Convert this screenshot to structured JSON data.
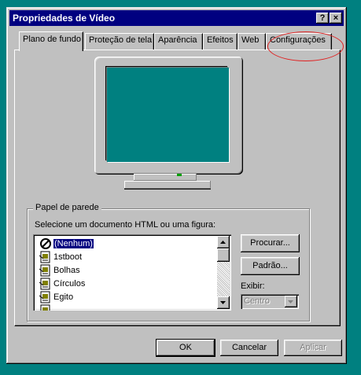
{
  "window": {
    "title": "Propriedades de Vídeo",
    "help_glyph": "?",
    "close_glyph": "×"
  },
  "tabs": [
    {
      "label": "Plano de fundo",
      "active": true
    },
    {
      "label": "Proteção de tela"
    },
    {
      "label": "Aparência"
    },
    {
      "label": "Efeitos"
    },
    {
      "label": "Web"
    },
    {
      "label": "Configurações"
    }
  ],
  "wallpaper": {
    "group_label": "Papel de parede",
    "select_label": "Selecione um documento HTML ou uma figura:",
    "items": [
      {
        "label": "(Nenhum)",
        "icon": "none-icon",
        "selected": true
      },
      {
        "label": "1stboot",
        "icon": "wallpaper-file-icon"
      },
      {
        "label": "Bolhas",
        "icon": "wallpaper-file-icon"
      },
      {
        "label": "Círculos",
        "icon": "wallpaper-file-icon"
      },
      {
        "label": "Egito",
        "icon": "wallpaper-file-icon"
      }
    ],
    "browse_label": "Procurar...",
    "pattern_label": "Padrão...",
    "display_label": "Exibir:",
    "display_value": "Centro"
  },
  "footer": {
    "ok_label": "OK",
    "cancel_label": "Cancelar",
    "apply_label": "Aplicar"
  },
  "colors": {
    "desktop": "#008080",
    "titlebar": "#000080",
    "annotation": "#e02020"
  }
}
